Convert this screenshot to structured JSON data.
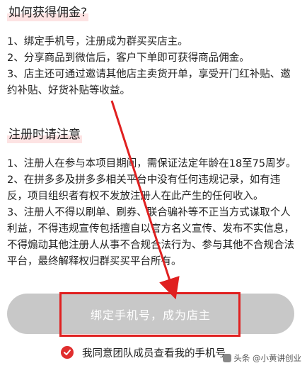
{
  "section1": {
    "title": "如何获得佣金?",
    "items": [
      "1、绑定手机号，注册成为群买买店主。",
      "2、分享商品到微信后，客户下单即可获得商品佣金。",
      "3、店主还可通过邀请其他店主卖货开单，享受开门红补贴、邀约补贴、好货补贴等收益。"
    ]
  },
  "section2": {
    "title": "注册时请注意",
    "items": [
      "1、注册人在参与本项目期间，需保证法定年龄在18至75周岁。",
      "2、在拼多多及拼多多相关平台中没有任何违规记录，如有违反，项目组织者有权不发放注册人在此产生的任何收入。",
      "3、注册人不得以刷单、刷券、联合骗补等不正当方式谋取个人利益，不得违规宣传包括擅自以官方名义宣传、发布不实信息，不得煽动其他注册人从事不合规合法行为、参与其他不合规合法平台，最终解释权归群买买平台所有。"
    ]
  },
  "bind_button": {
    "label": "绑定手机号，成为店主"
  },
  "agreement": {
    "label": "我同意团队成员查看我的手机号",
    "checked": true
  },
  "watermark": {
    "text": "头条 @小黄讲创业"
  },
  "colors": {
    "accent": "#e02e2e",
    "button_disabled": "#c8c8c8",
    "title_highlight": "#fde3e3"
  }
}
